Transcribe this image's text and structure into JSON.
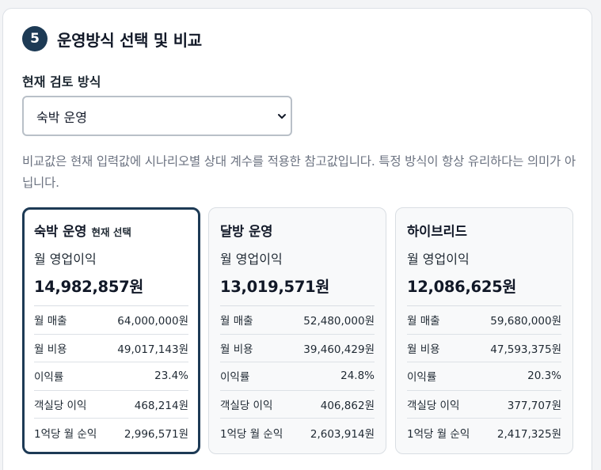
{
  "section": {
    "step": "5",
    "title": "운영방식 선택 및 비교"
  },
  "selector": {
    "label": "현재 검토 방식",
    "selected": "숙박 운영"
  },
  "note": "비교값은 현재 입력값에 시나리오별 상대 계수를 적용한 참고값입니다. 특정 방식이 항상 유리하다는 의미가 아닙니다.",
  "cards": [
    {
      "name": "숙박 운영",
      "tag": "현재 선택",
      "metric_label": "월 영업이익",
      "metric_value": "14,982,857원",
      "rows": [
        {
          "label": "월 매출",
          "value": "64,000,000원"
        },
        {
          "label": "월 비용",
          "value": "49,017,143원"
        },
        {
          "label": "이익률",
          "value": "23.4%"
        },
        {
          "label": "객실당 이익",
          "value": "468,214원"
        },
        {
          "label": "1억당 월 순익",
          "value": "2,996,571원"
        }
      ]
    },
    {
      "name": "달방 운영",
      "metric_label": "월 영업이익",
      "metric_value": "13,019,571원",
      "rows": [
        {
          "label": "월 매출",
          "value": "52,480,000원"
        },
        {
          "label": "월 비용",
          "value": "39,460,429원"
        },
        {
          "label": "이익률",
          "value": "24.8%"
        },
        {
          "label": "객실당 이익",
          "value": "406,862원"
        },
        {
          "label": "1억당 월 순익",
          "value": "2,603,914원"
        }
      ]
    },
    {
      "name": "하이브리드",
      "metric_label": "월 영업이익",
      "metric_value": "12,086,625원",
      "rows": [
        {
          "label": "월 매출",
          "value": "59,680,000원"
        },
        {
          "label": "월 비용",
          "value": "47,593,375원"
        },
        {
          "label": "이익률",
          "value": "20.3%"
        },
        {
          "label": "객실당 이익",
          "value": "377,707원"
        },
        {
          "label": "1억당 월 순익",
          "value": "2,417,325원"
        }
      ]
    }
  ],
  "colors": {
    "accent": "#1d3a55",
    "muted_text": "#6b7280",
    "card_bg": "#f8f9fa"
  }
}
